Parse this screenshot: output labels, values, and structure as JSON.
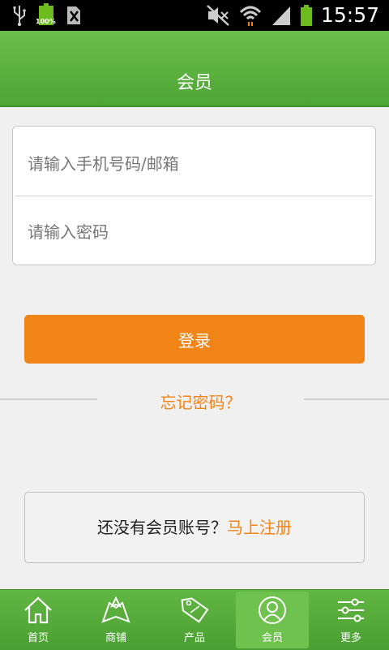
{
  "status_bar": {
    "time": "15:57",
    "battery_percent_label": "100%",
    "icons": [
      "usb-icon",
      "battery-icon",
      "no-sim-icon",
      "mute-icon",
      "wifi-icon",
      "signal-icon",
      "battery-icon"
    ]
  },
  "header": {
    "title": "会员"
  },
  "login_form": {
    "phone_placeholder": "请输入手机号码/邮箱",
    "password_placeholder": "请输入密码",
    "login_label": "登录"
  },
  "forgot_label": "忘记密码？",
  "register": {
    "prompt": "还没有会员账号？",
    "link": "马上注册"
  },
  "bottom_nav": {
    "items": [
      {
        "label": "首页",
        "icon": "home-icon"
      },
      {
        "label": "商铺",
        "icon": "store-map-icon"
      },
      {
        "label": "产品",
        "icon": "sale-tag-icon"
      },
      {
        "label": "会员",
        "icon": "member-icon"
      },
      {
        "label": "更多",
        "icon": "settings-sliders-icon"
      }
    ],
    "active_index": 3
  },
  "colors": {
    "header_green": "#5cb33c",
    "accent_orange": "#f08417",
    "background": "#f0f0f0"
  }
}
